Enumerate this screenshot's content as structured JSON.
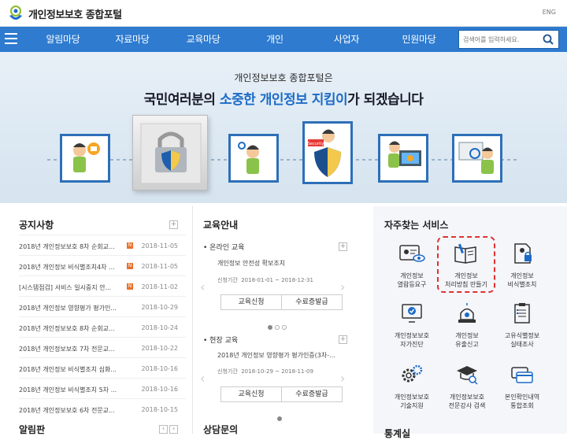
{
  "header": {
    "title": "개인정보보호 종합포털",
    "lang": "ENG"
  },
  "nav": {
    "items": [
      "알림마당",
      "자료마당",
      "교육마당",
      "개인",
      "사업자",
      "민원마당"
    ],
    "search_placeholder": "검색어를 입력하세요."
  },
  "banner": {
    "line1": "개인정보보호 종합포털은",
    "line2_pre": "국민여러분의 ",
    "line2_hl": "소중한 개인정보 지킴이",
    "line2_post": "가 되겠습니다",
    "security_tag": "Security"
  },
  "notices": {
    "title": "공지사항",
    "rows": [
      {
        "text": "2018년 개인정보보호 8차 순회교...",
        "date": "2018-11-05",
        "new": "N"
      },
      {
        "text": "2018년 개인정보 비식별조치4차 ...",
        "date": "2018-11-05",
        "new": "N"
      },
      {
        "text": "[시스템점검] 서비스 일시중지 안...",
        "date": "2018-11-02",
        "new": "N"
      },
      {
        "text": "2018년 개인정보 영향평가 평가인...",
        "date": "2018-10-29",
        "new": ""
      },
      {
        "text": "2018년 개인정보보호 8차 순회교...",
        "date": "2018-10-24",
        "new": ""
      },
      {
        "text": "2018년 개인정보보호 7차 전문교...",
        "date": "2018-10-22",
        "new": ""
      },
      {
        "text": "2018년 개인정보 비식별조치 심화...",
        "date": "2018-10-16",
        "new": ""
      },
      {
        "text": "2018년 개인정보 비식별조치 5차 ...",
        "date": "2018-10-16",
        "new": ""
      },
      {
        "text": "2018년 개인정보보호 6차 전문교...",
        "date": "2018-10-15",
        "new": ""
      }
    ],
    "board_title": "알림판"
  },
  "education": {
    "title": "교육안내",
    "online": {
      "label": "• 온라인 교육",
      "course": "개인정보 안전성 확보조치",
      "period_label": "신청기간",
      "period": "2018-01-01 ~ 2018-12-31"
    },
    "onsite": {
      "label": "• 현장 교육",
      "course": "2018년 개인정보 영향평가 평가인증(3차-...",
      "period_label": "신청기간",
      "period": "2018-10-29 ~ 2018-11-09"
    },
    "apply_btn": "교육신청",
    "cert_btn": "수료증발급",
    "consult_title": "상담문의"
  },
  "services": {
    "title": "자주찾는 서비스",
    "items": [
      {
        "l1": "개인정보",
        "l2": "열람등요구",
        "icon": "id-card-eye-icon"
      },
      {
        "l1": "개인정보",
        "l2": "처리방침 만들기",
        "icon": "book-pen-icon"
      },
      {
        "l1": "개인정보",
        "l2": "비식별조치",
        "icon": "document-lock-icon"
      },
      {
        "l1": "개인정보보호",
        "l2": "자가진단",
        "icon": "monitor-check-icon"
      },
      {
        "l1": "개인정보",
        "l2": "유출신고",
        "icon": "siren-icon"
      },
      {
        "l1": "고유식별정보",
        "l2": "실태조사",
        "icon": "clipboard-icon"
      },
      {
        "l1": "개인정보보호",
        "l2": "기술지원",
        "icon": "gears-icon"
      },
      {
        "l1": "개인정보보호",
        "l2": "전문강사 검색",
        "icon": "graduation-search-icon"
      },
      {
        "l1": "본인확인내역",
        "l2": "통합조회",
        "icon": "cards-icon"
      }
    ],
    "stats_title": "통계실"
  }
}
